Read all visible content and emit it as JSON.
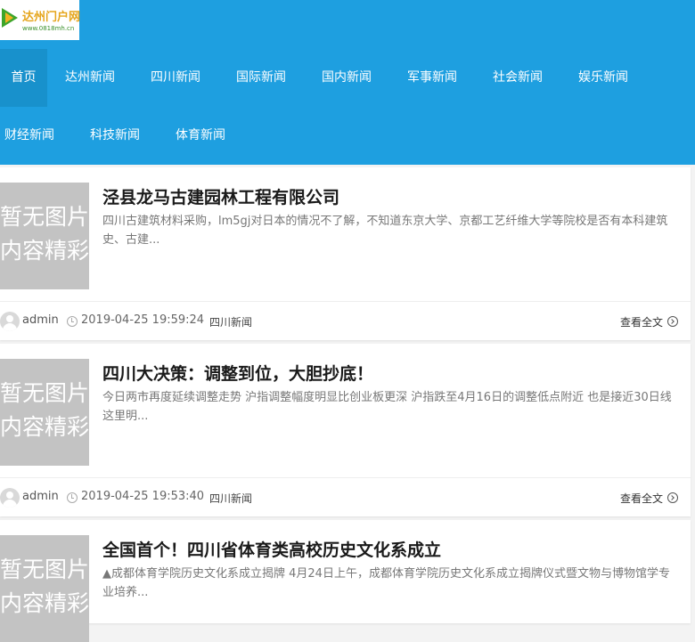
{
  "site": {
    "logo_text": "达州门户网",
    "logo_url": "www.0818mh.cn"
  },
  "nav": {
    "items": [
      {
        "label": "首页"
      },
      {
        "label": "达州新闻"
      },
      {
        "label": "四川新闻"
      },
      {
        "label": "国际新闻"
      },
      {
        "label": "国内新闻"
      },
      {
        "label": "军事新闻"
      },
      {
        "label": "社会新闻"
      },
      {
        "label": "娱乐新闻"
      },
      {
        "label": "财经新闻"
      },
      {
        "label": "科技新闻"
      },
      {
        "label": "体育新闻"
      }
    ]
  },
  "placeholder_image": {
    "line1": "暂无图片",
    "line2": "内容精彩"
  },
  "articles": [
    {
      "title": "泾县龙马古建园林工程有限公司",
      "excerpt": "四川古建筑材料采购，lm5gj对日本的情况不了解，不知道东京大学、京都工艺纤维大学等院校是否有本科建筑史、古建...",
      "author": "admin",
      "date": "2019-04-25 19:59:24",
      "category": "四川新闻",
      "read_more": "查看全文"
    },
    {
      "title": "四川大决策：调整到位，大胆抄底！",
      "excerpt": "今日两市再度延续调整走势 沪指调整幅度明显比创业板更深 沪指跌至4月16日的调整低点附近 也是接近30日线 这里明...",
      "author": "admin",
      "date": "2019-04-25 19:53:40",
      "category": "四川新闻",
      "read_more": "查看全文"
    },
    {
      "title": "全国首个！四川省体育类高校历史文化系成立",
      "excerpt": "▲成都体育学院历史文化系成立揭牌 4月24日上午，成都体育学院历史文化系成立揭牌仪式暨文物与博物馆学专业培养..."
    }
  ]
}
